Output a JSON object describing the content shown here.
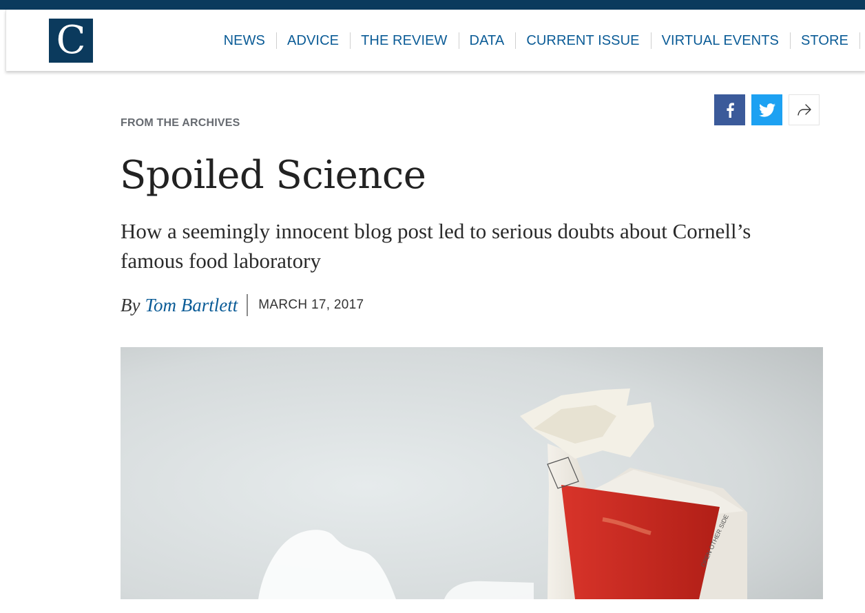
{
  "header": {
    "logo_letter": "C",
    "nav": [
      "NEWS",
      "ADVICE",
      "THE REVIEW",
      "DATA",
      "CURRENT ISSUE",
      "VIRTUAL EVENTS",
      "STORE"
    ]
  },
  "share": {
    "icons": [
      "facebook-icon",
      "twitter-icon",
      "share-arrow-icon"
    ]
  },
  "article": {
    "kicker": "FROM THE ARCHIVES",
    "title": "Spoiled Science",
    "dek": "How a seemingly innocent blog post led to serious doubts about Cornell’s famous food laboratory",
    "byline_prefix": "By",
    "author": "Tom Bartlett",
    "date": "MARCH 17, 2017"
  },
  "hero": {
    "carton_side_text": "OPEN OTHER SIDE"
  },
  "colors": {
    "brand_navy": "#0b3a5d",
    "link_blue": "#0a5b96",
    "facebook": "#3b5a9a",
    "twitter": "#1da1f2",
    "carton_red": "#c8251c"
  }
}
